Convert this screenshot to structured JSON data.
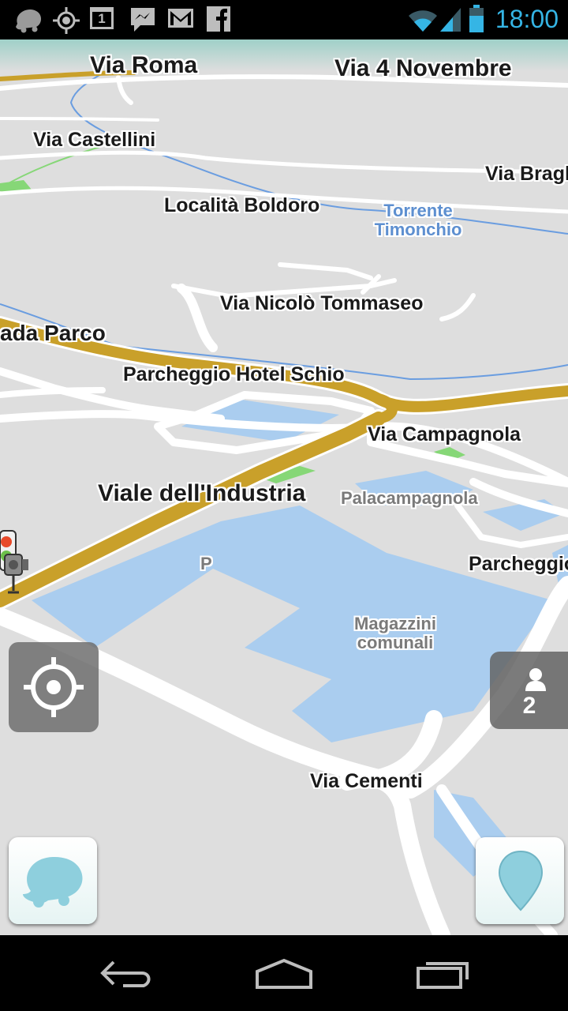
{
  "status_bar": {
    "time": "18:00",
    "notification_icons": [
      "waze-icon",
      "gps-icon",
      "calendar-icon",
      "messenger-icon",
      "gmail-icon",
      "facebook-icon"
    ],
    "calendar_day": "1",
    "system_icons": [
      "wifi-icon",
      "signal-icon",
      "battery-icon"
    ]
  },
  "map": {
    "street_labels": [
      "Via Roma",
      "Via 4 Novembre",
      "Via Castellini",
      "Via Bragh",
      "Località Boldoro",
      "Via Nicolò Tommaseo",
      "ada Parco",
      "Parcheggio Hotel Schio",
      "Via Campagnola",
      "Viale dell'Industria",
      "Parcheggio",
      "Via Cementi"
    ],
    "water_label": "Torrente Timonchio",
    "poi_labels": {
      "palacampagnola": "Palacampagnola",
      "magazzini": "Magazzini comunali",
      "parking": "P"
    }
  },
  "controls": {
    "recenter_icon": "crosshair-icon",
    "users_icon": "person-icon",
    "users_count": "2",
    "waze_menu_icon": "waze-icon",
    "report_icon": "location-pin-icon"
  },
  "nav_bar": {
    "buttons": [
      "back-icon",
      "home-icon",
      "recent-apps-icon"
    ]
  },
  "colors": {
    "status_clock": "#35b5e5",
    "map_background": "#dedede",
    "main_road": "#c9a02a",
    "road": "#ffffff",
    "water": "#aacdef",
    "river": "#6a9de0",
    "park": "#7fd66f"
  }
}
